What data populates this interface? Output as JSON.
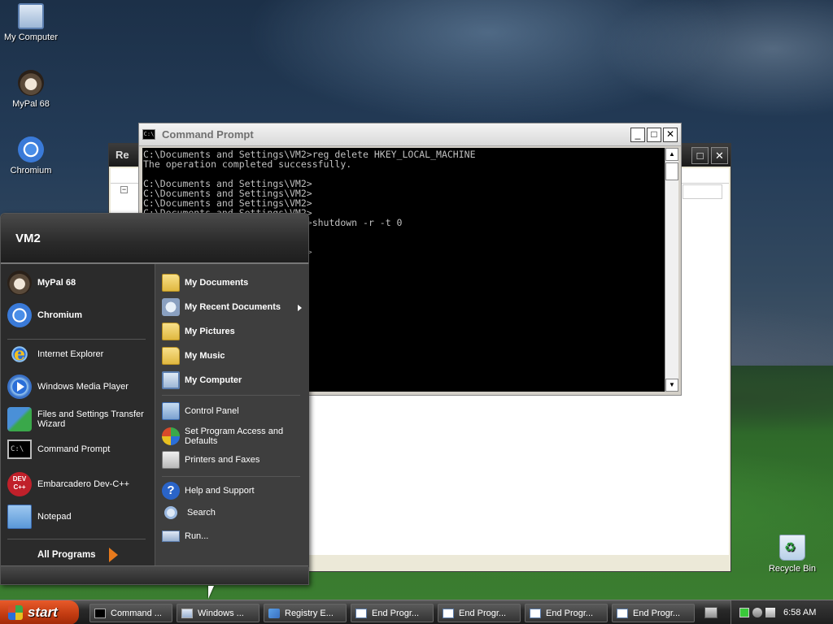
{
  "desktop": {
    "icons": [
      {
        "label": "My Computer",
        "icon": "my-computer-icon"
      },
      {
        "label": "MyPal 68",
        "icon": "mypal-icon"
      },
      {
        "label": "Chromium",
        "icon": "chromium-icon"
      },
      {
        "label": "Recycle Bin",
        "icon": "recycle-bin-icon"
      }
    ]
  },
  "registry_window": {
    "title_partial": "Re"
  },
  "cmd_window": {
    "title": "Command Prompt",
    "icon_text": "C:\\",
    "minimize": "_",
    "maximize": "□",
    "close": "✕",
    "lines": [
      "C:\\Documents and Settings\\VM2>reg delete HKEY_LOCAL_MACHINE",
      "The operation completed successfully.",
      "",
      "C:\\Documents and Settings\\VM2>",
      "C:\\Documents and Settings\\VM2>",
      "C:\\Documents and Settings\\VM2>",
      "C:\\Documents and Settings\\VM2>",
      "C:\\Documents and Settings\\VM2>shutdown -r -t 0",
      "",
      "",
      "C:\\Documents and Settings\\VM2>"
    ]
  },
  "start_menu": {
    "user": "VM2",
    "pinned": [
      {
        "label": "MyPal 68"
      },
      {
        "label": "Chromium"
      }
    ],
    "recent": [
      {
        "label": "Internet Explorer"
      },
      {
        "label": "Windows Media Player"
      },
      {
        "label": "Files and Settings Transfer Wizard"
      },
      {
        "label": "Command Prompt"
      },
      {
        "label": "Embarcadero Dev-C++"
      },
      {
        "label": "Notepad"
      }
    ],
    "all_programs": "All Programs",
    "places": [
      {
        "label": "My Documents"
      },
      {
        "label": "My Recent Documents"
      },
      {
        "label": "My Pictures"
      },
      {
        "label": "My Music"
      },
      {
        "label": "My Computer"
      }
    ],
    "settings": [
      {
        "label": "Control Panel"
      },
      {
        "label": "Set Program Access and Defaults"
      },
      {
        "label": "Printers and Faxes"
      }
    ],
    "tools": [
      {
        "label": "Help and Support"
      },
      {
        "label": "Search"
      },
      {
        "label": "Run..."
      }
    ],
    "dev_icon_text": "DEV C++",
    "help_icon_text": "?"
  },
  "taskbar": {
    "start_label": "start",
    "buttons": [
      {
        "label": "Command ..."
      },
      {
        "label": "Windows ..."
      },
      {
        "label": "Registry E..."
      },
      {
        "label": "End Progr..."
      },
      {
        "label": "End Progr..."
      },
      {
        "label": "End Progr..."
      },
      {
        "label": "End Progr..."
      }
    ],
    "clock": "6:58 AM"
  }
}
